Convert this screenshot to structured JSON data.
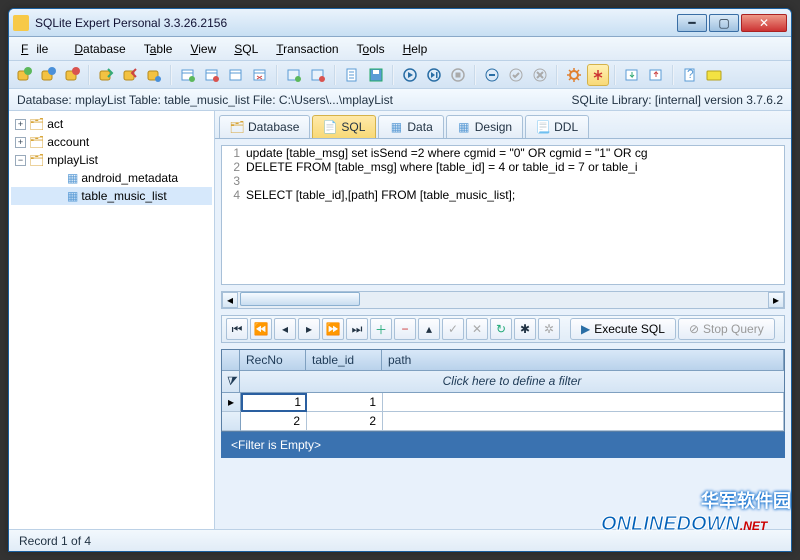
{
  "window": {
    "title": "SQLite Expert Personal 3.3.26.2156"
  },
  "menu": {
    "file": "File",
    "database": "Database",
    "table": "Table",
    "view": "View",
    "sql": "SQL",
    "transaction": "Transaction",
    "tools": "Tools",
    "help": "Help"
  },
  "info": {
    "left": "Database: mplayList   Table: table_music_list   File: C:\\Users\\...\\mplayList",
    "right": "SQLite Library: [internal] version 3.7.6.2"
  },
  "tree": {
    "items": [
      {
        "label": "act",
        "type": "db",
        "expanded": false,
        "indent": 0
      },
      {
        "label": "account",
        "type": "db",
        "expanded": false,
        "indent": 0
      },
      {
        "label": "mplayList",
        "type": "db",
        "expanded": true,
        "indent": 0
      },
      {
        "label": "android_metadata",
        "type": "table",
        "indent": 2
      },
      {
        "label": "table_music_list",
        "type": "table",
        "indent": 2,
        "selected": true
      }
    ]
  },
  "tabs": {
    "database": "Database",
    "sql": "SQL",
    "data": "Data",
    "design": "Design",
    "ddl": "DDL"
  },
  "sql": {
    "lines": [
      "update [table_msg] set isSend =2 where cgmid = \"0\" OR cgmid = \"1\" OR cg",
      "DELETE FROM [table_msg] where [table_id] = 4 or table_id = 7 or table_i",
      "",
      "SELECT [table_id],[path] FROM [table_music_list];"
    ]
  },
  "exec": {
    "execute": "Execute SQL",
    "stop": "Stop Query"
  },
  "grid": {
    "cols": {
      "recno": "RecNo",
      "table_id": "table_id",
      "path": "path"
    },
    "filter_hint": "Click here to define a filter",
    "rows": [
      {
        "recno": "1",
        "table_id": "1",
        "path": ""
      },
      {
        "recno": "2",
        "table_id": "2",
        "path": ""
      }
    ],
    "filter_status": "<Filter is Empty>"
  },
  "status": {
    "text": "Record 1 of 4"
  },
  "watermark": {
    "cn": "华军软件园",
    "en": "ONLINEDOWN",
    "net": ".NET"
  }
}
